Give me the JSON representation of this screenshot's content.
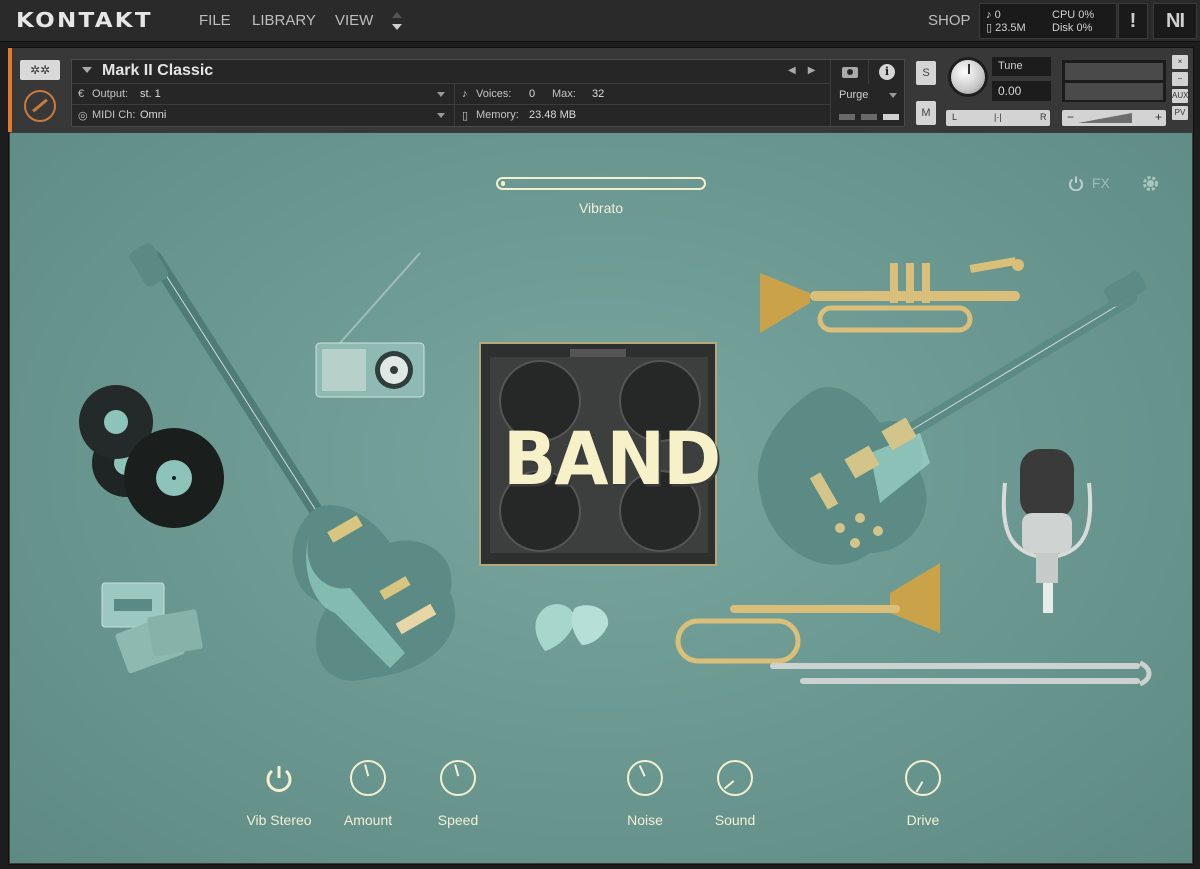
{
  "app": {
    "logo": "KONTAKT",
    "menu": [
      "FILE",
      "LIBRARY",
      "VIEW"
    ],
    "shop": "SHOP",
    "stats": {
      "voices": "0",
      "memory": "23.5M",
      "cpu_label": "CPU",
      "cpu_value": "0%",
      "disk_label": "Disk",
      "disk_value": "0%"
    },
    "warning": "!",
    "ni_logo": "NI"
  },
  "instrument": {
    "name": "Mark II Classic",
    "output_label": "Output:",
    "output_value": "st. 1",
    "midi_label": "MIDI Ch:",
    "midi_value": "Omni",
    "voices_label": "Voices:",
    "voices_value": "0",
    "max_label": "Max:",
    "max_value": "32",
    "memory_label": "Memory:",
    "memory_value": "23.48 MB",
    "purge": "Purge",
    "solo": "S",
    "mute": "M",
    "tune_label": "Tune",
    "tune_value": "0.00",
    "pan_left": "L",
    "pan_right": "R",
    "vol_minus": "−",
    "vol_plus": "+",
    "side_buttons": [
      "×",
      "−",
      "AUX",
      "PV"
    ]
  },
  "panel": {
    "vibrato_label": "Vibrato",
    "fx_label": "FX",
    "band_title": "BAND",
    "controls": [
      {
        "label": "Vib Stereo",
        "type": "power"
      },
      {
        "label": "Amount",
        "type": "knob",
        "value": 0.45
      },
      {
        "label": "Speed",
        "type": "knob",
        "value": 0.45
      },
      {
        "label": "Noise",
        "type": "knob",
        "value": 0.42
      },
      {
        "label": "Sound",
        "type": "knob",
        "value": 0.15
      },
      {
        "label": "Drive",
        "type": "knob",
        "value": 0.2
      }
    ]
  },
  "colors": {
    "accent": "#e07a2e",
    "panel_bg": "#6c9a93",
    "cream": "#f4efd0"
  }
}
